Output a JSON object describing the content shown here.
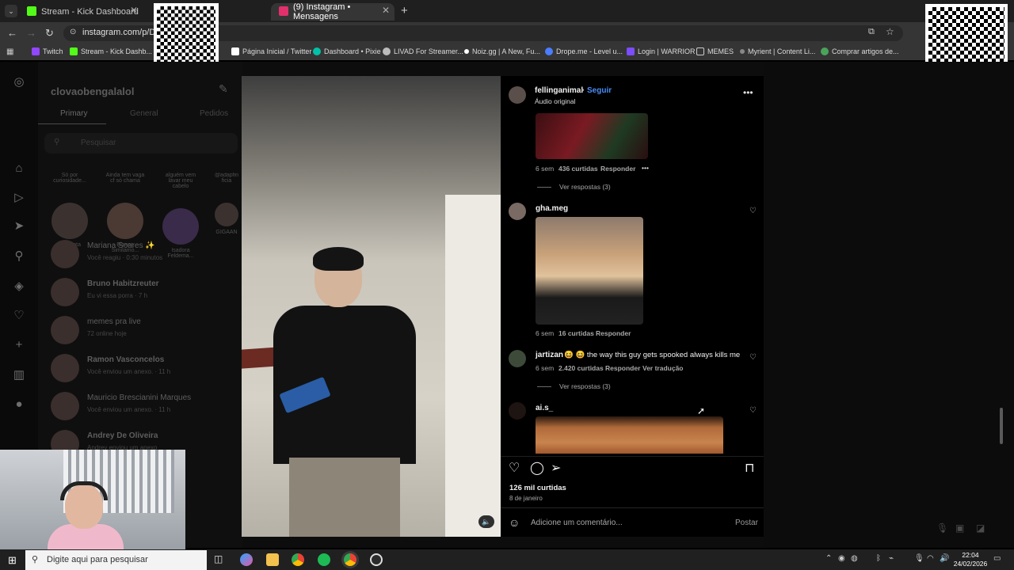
{
  "browser": {
    "tabs": [
      {
        "label": "Stream - Kick Dashboard",
        "favicon_color": "#53fc18"
      },
      {
        "label": "(9) Instagram • Mensagens",
        "favicon_color": "#e1306c"
      }
    ],
    "url": "instagram.com/p/DTP",
    "bookmarks": [
      {
        "label": "Twitch",
        "color": "#9146ff"
      },
      {
        "label": "Stream - Kick Dashb...",
        "color": "#53fc18"
      },
      {
        "label": "Página Inicial / Twitter",
        "color": "#ffffff"
      },
      {
        "label": "Dashboard • Pixie",
        "color": "#00c2a8"
      },
      {
        "label": "LIVAD For Streamer...",
        "color": "#bbbbbb"
      },
      {
        "label": "Noiz.gg | A New, Fu...",
        "color": "#ffffff"
      },
      {
        "label": "Drope.me - Level u...",
        "color": "#4a7dff"
      },
      {
        "label": "Login | WARRIOR",
        "color": "#7c4dff"
      },
      {
        "label": "MEMES",
        "color": "#d0d0d0"
      },
      {
        "label": "Myrient | Content Li...",
        "color": "#888888"
      },
      {
        "label": "Comprar artigos de...",
        "color": "#4aa35a"
      }
    ]
  },
  "dm": {
    "username": "clovaobengalalol",
    "tabs": [
      "Primary",
      "General",
      "Pedidos"
    ],
    "search_placeholder": "Pesquisar",
    "notes": [
      {
        "text": "Só por curiosidade...",
        "name": "Sua nota"
      },
      {
        "text": "Ainda tem vaga cf só chama",
        "name": "Bianca Similamo..."
      },
      {
        "text": "alguém vem lavar meu cabelo",
        "name": "Isadora Feldema..."
      },
      {
        "text": "@adapfin ficia",
        "name": "GIGAAN"
      }
    ],
    "conversations": [
      {
        "name": "Mariana Soares ✨",
        "sub": "Você reagiu · 0:30 minutos"
      },
      {
        "name": "Bruno Habitzreuter",
        "sub": "Eu vi essa porra · 7 h"
      },
      {
        "name": "memes pra live",
        "sub": "72 online hoje"
      },
      {
        "name": "Ramon Vasconcelos",
        "sub": "Você enviou um anexo. · 11 h"
      },
      {
        "name": "Mauricio Brescianini Marques",
        "sub": "Você enviou um anexo. · 11 h"
      },
      {
        "name": "Andrey De Oliveira",
        "sub": "Andrey enviou um anexo"
      }
    ]
  },
  "post": {
    "author": "fellinganimal",
    "follow": "Seguir",
    "audio": "Áudio original",
    "comments": [
      {
        "user": "",
        "time": "6 sem",
        "likes": "436 curtidas",
        "reply": "Responder",
        "more": "•••",
        "view_replies": "Ver respostas (3)"
      },
      {
        "user": "gha.meg",
        "time": "6 sem",
        "likes": "16 curtidas",
        "reply": "Responder"
      },
      {
        "user": "jartizan",
        "text": "😆 😆 the way this guy gets spooked always kills me",
        "time": "6 sem",
        "likes": "2.420 curtidas",
        "reply": "Responder",
        "translate": "Ver tradução",
        "view_replies": "Ver respostas (3)"
      },
      {
        "user": "ai.s_"
      }
    ],
    "likes_total": "126 mil curtidas",
    "date": "8 de janeiro",
    "comment_placeholder": "Adicione um comentário...",
    "post_button": "Postar",
    "mute_icon": "🔈"
  },
  "taskbar": {
    "search_placeholder": "Digite aqui para pesquisar",
    "time": "22:04",
    "date": "24/02/2026"
  }
}
